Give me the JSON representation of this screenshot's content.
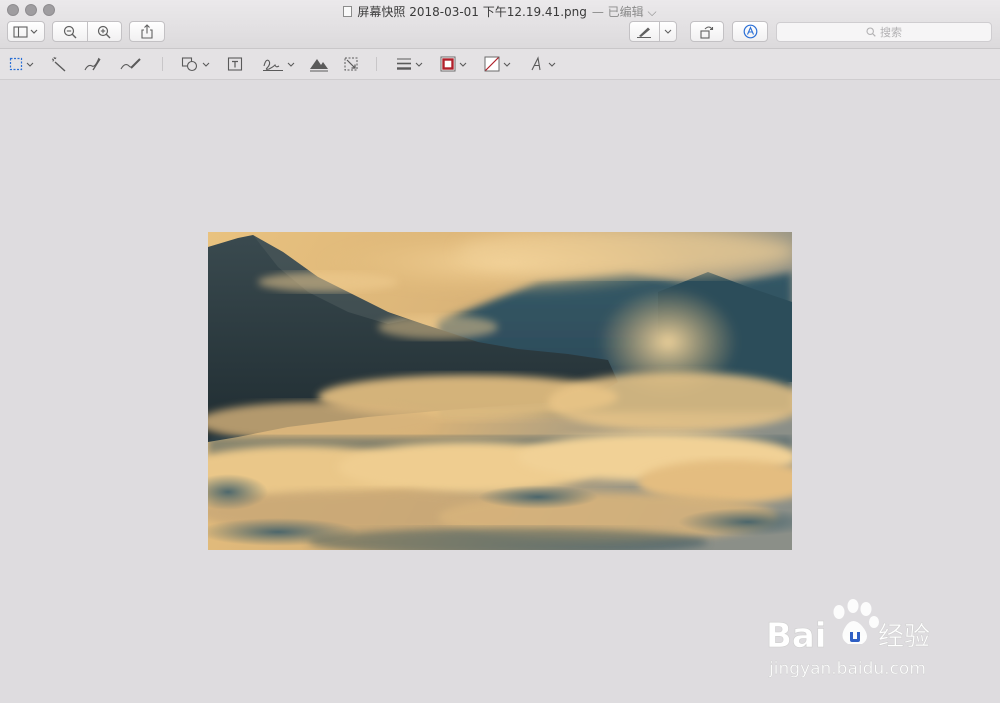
{
  "window": {
    "title": "屏幕快照 2018-03-01 下午12.19.41.png",
    "edited_label": "— 已编辑 ⌵"
  },
  "toolbar": {
    "search_placeholder": "搜索",
    "sidebar_icon": "sidebar-icon",
    "zoom_out_icon": "zoom-out-icon",
    "zoom_in_icon": "zoom-in-icon",
    "share_icon": "share-icon",
    "markup_pen_icon": "pen-icon",
    "rotate_icon": "rotate-icon",
    "markup_icon": "markup-circle-icon"
  },
  "markup_toolbar": {
    "tools": [
      "rectangular-selection-icon",
      "instant-alpha-icon",
      "sketch-icon",
      "draw-icon",
      "shapes-icon",
      "text-box-icon",
      "signature-icon",
      "adjust-color-icon",
      "adjust-size-icon",
      "line-style-icon",
      "border-color-icon",
      "fill-color-icon",
      "text-style-icon"
    ],
    "border_color": "#b0202a"
  },
  "watermark": {
    "brand": "Bai",
    "brand2": "du",
    "product": "经验",
    "url": "jingyan.baidu.com"
  },
  "colors": {
    "background": "#dedcdf",
    "accent": "#2a6fd6"
  }
}
